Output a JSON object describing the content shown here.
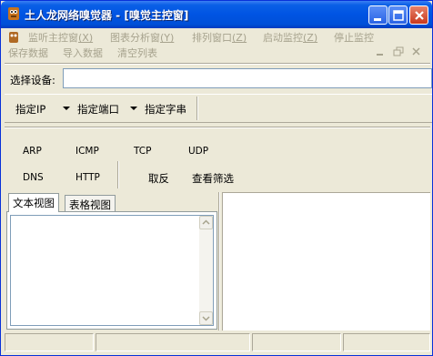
{
  "window": {
    "title": "土人龙网络嗅觉器 - [嗅觉主控窗]",
    "colors": {
      "titlebar": "#0054E3",
      "face": "#ECE9D8",
      "disabled_text": "#A7A38E"
    }
  },
  "menu": {
    "row1": [
      {
        "label": "监听主控窗",
        "accel": "(X)"
      },
      {
        "label": "图表分析窗",
        "accel": "(Y)"
      },
      {
        "label": "排列窗口",
        "accel": "(Z)"
      },
      {
        "label": "启动监控",
        "accel": "(Z)"
      },
      {
        "label": "停止监控",
        "accel": ""
      }
    ],
    "row2": [
      "保存数据",
      "导入数据",
      "清空列表"
    ]
  },
  "device": {
    "label": "选择设备:",
    "value": ""
  },
  "filters": {
    "ip": "指定IP",
    "port": "指定端口",
    "string": "指定字串"
  },
  "protocols": {
    "row1": [
      "ARP",
      "ICMP",
      "TCP",
      "UDP"
    ],
    "row2": [
      "DNS",
      "HTTP"
    ],
    "invert": "取反",
    "view_filter": "查看筛选"
  },
  "tabs": [
    "文本视图",
    "表格视图"
  ],
  "icons": [
    "app-icon",
    "minimize-icon",
    "maximize-icon",
    "close-icon",
    "dropdown-arrow-icon",
    "scroll-up-icon",
    "scroll-down-icon"
  ]
}
